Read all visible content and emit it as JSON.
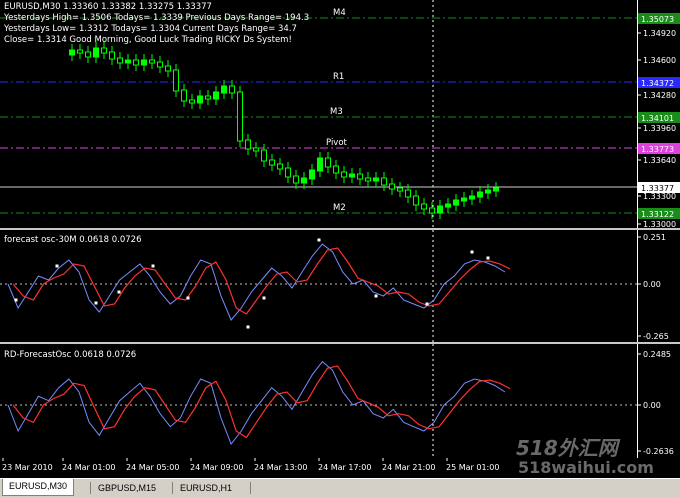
{
  "main_chart": {
    "title": "EURUSD,M30  1.33360 1.33382 1.33275 1.33377",
    "info_lines": [
      "Yesterdays High= 1.3506  Todays= 1.3339    Previous Days Range= 194.3",
      "Yesterdays Low= 1.3312   Todays= 1.3304    Current Days Range= 34.7",
      "Close= 1.3314    Good Morning, Good Luck Trading RICKY Ds System!"
    ],
    "levels": [
      {
        "label": "M4",
        "price": "1.35073",
        "color": "#1a8c1a",
        "style": "dashdot"
      },
      {
        "label": "R1",
        "price": "1.34372",
        "color": "#2a2aff",
        "style": "dashdot"
      },
      {
        "label": "M3",
        "price": "1.34101",
        "color": "#1a8c1a",
        "style": "dashdot"
      },
      {
        "label": "Pivot",
        "price": "1.33773",
        "color": "#e040e0",
        "style": "dashdot"
      },
      {
        "label": "M2",
        "price": "1.33122",
        "color": "#1a8c1a",
        "style": "dashdot"
      }
    ],
    "current_price": "1.33377",
    "price_ticks": [
      "1.34920",
      "1.34600",
      "1.34280",
      "1.33960",
      "1.33640",
      "1.33300",
      "1.33000"
    ],
    "colors": {
      "bull": "#00ff00",
      "bear": "#000000",
      "bear_outline": "#00ff00",
      "hline": "#ffffff"
    }
  },
  "osc1": {
    "title": "forecast osc-30M 0.0618 0.0726",
    "ticks": [
      "0.251",
      "0.00",
      "-0.265"
    ],
    "colors": {
      "fast": "#ff3030",
      "slow": "#7a8cff",
      "dots": "#ffffff"
    }
  },
  "osc2": {
    "title": "RD-ForecastOsc 0.0618 0.0726",
    "ticks": [
      "0.2485",
      "0.00",
      "-0.2636"
    ],
    "colors": {
      "fast": "#ff3030",
      "slow": "#7a8cff"
    }
  },
  "time_axis": [
    "23 Mar 2010",
    "24 Mar 01:00",
    "24 Mar 05:00",
    "24 Mar 09:00",
    "24 Mar 13:00",
    "24 Mar 17:00",
    "24 Mar 21:00",
    "25 Mar 01:00"
  ],
  "tabs": [
    "EURUSD,M30",
    "GBPUSD,M15",
    "EURUSD,H1"
  ],
  "watermark": {
    "top": "518外汇网",
    "bottom": "518waihui.com"
  }
}
